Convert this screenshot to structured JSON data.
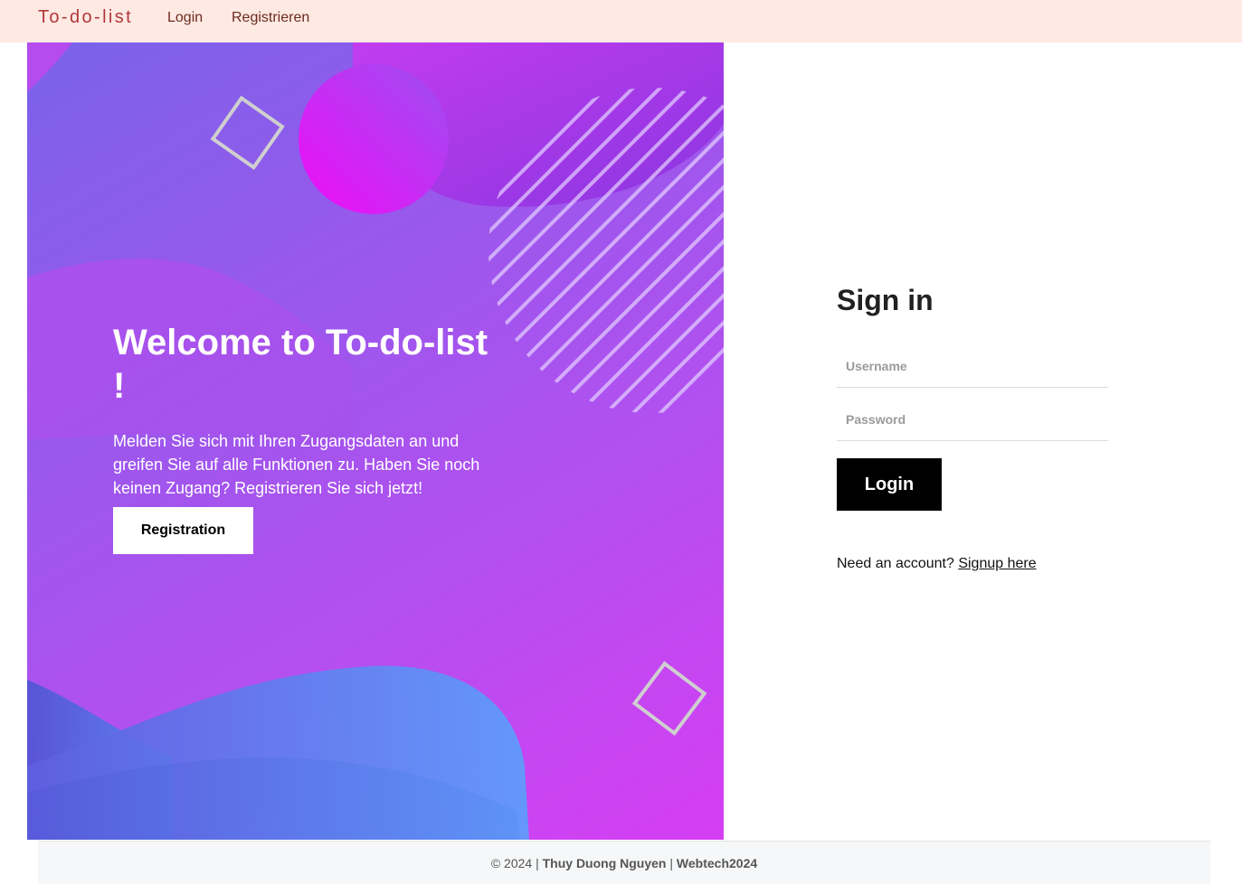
{
  "navbar": {
    "brand": "To-do-list",
    "links": [
      "Login",
      "Registrieren"
    ],
    "background": "#ffe9e3",
    "brand_color": "#b1373a"
  },
  "hero": {
    "title": "Welcome to To-do-list !",
    "text": "Melden Sie sich mit Ihren Zugangsdaten an und greifen Sie auf alle Funktionen zu. Haben Sie noch keinen Zugang? Registrieren Sie sich jetzt!",
    "button_label": "Registration",
    "gradient_colors": [
      "#7a62ea",
      "#b44ff0",
      "#d53ef3"
    ]
  },
  "signin": {
    "title": "Sign in",
    "username_placeholder": "Username",
    "password_placeholder": "Password",
    "login_label": "Login",
    "account_prompt": "Need an account?",
    "signup_link": "Signup here"
  },
  "footer": {
    "copyright": "© 2024 |",
    "author": "Thuy Duong Nguyen",
    "separator": "|",
    "project": "Webtech2024"
  }
}
